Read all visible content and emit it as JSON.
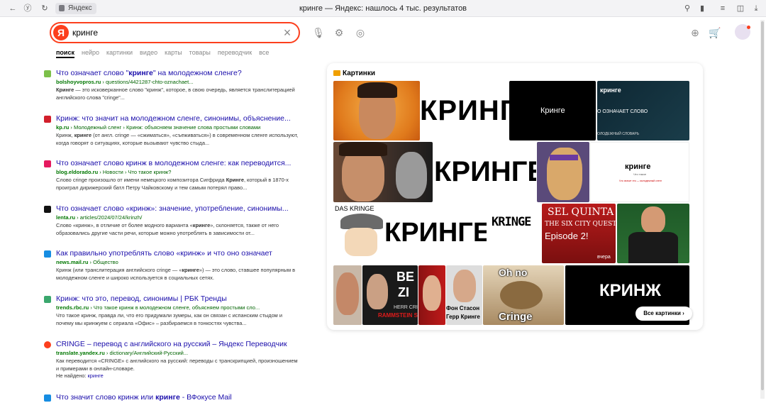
{
  "browser": {
    "site_chip": "Яндекс",
    "page_title": "кринге — Яндекс: нашлось 4 тыс. результатов"
  },
  "search": {
    "logo": "Я",
    "query": "кринге"
  },
  "tabs": [
    "поиск",
    "нейро",
    "картинки",
    "видео",
    "карты",
    "товары",
    "переводчик",
    "все"
  ],
  "results": [
    {
      "title_pre": "Что означает слово \"",
      "title_bold": "кринге",
      "title_post": "\" на молодежном сленге?",
      "host": "bolshoyvopros.ru",
      "path": " › questions/4421287-chto-oznachaet...",
      "snippet_bold": "Кринге",
      "snippet": " — это исковерканное слово \"кринж\", которое, в свою очередь, является транслитерацией английского слова \"cringe\"..."
    },
    {
      "title_pre": "Кринж: что значит на молодежном сленге, синонимы, объяснение...",
      "title_bold": "",
      "title_post": "",
      "host": "kp.ru",
      "path": " › Молодежный сленг › Кринж: объясняем значение слова простыми словами",
      "snippet_pre": "Кринж, ",
      "snippet_bold": "кринге",
      "snippet": " (от англ. cringe — «сжиматься», «съеживаться») в современном сленге используют, когда говорят о ситуациях, которые вызывают чувство стыда..."
    },
    {
      "title_pre": "Что означает слово кринж в молодежном сленге: как переводится...",
      "title_bold": "",
      "title_post": "",
      "host": "blog.eldorado.ru",
      "path": " › Новости › Что такое кринж?",
      "snippet_pre": "Слово cringe произошло от имени немецкого композитора Сигфрида ",
      "snippet_bold": "Кринге",
      "snippet": ", который в 1870-х проиграл дирижерский батл Петру Чайковскому и тем самым потерял право..."
    },
    {
      "title_pre": "Что означает слово «кринж»: значение, употребление, синонимы...",
      "title_bold": "",
      "title_post": "",
      "host": "lenta.ru",
      "path": " › articles/2024/07/24/krinzh/",
      "snippet_pre": "Слово «кринж», в отличие от более модного варианта «",
      "snippet_bold": "кринге",
      "snippet": "», склоняется, также от него образовались другие части речи, которые можно употреблять в зависимости от..."
    },
    {
      "title_pre": "Как правильно употреблять слово «кринж» и что оно означает",
      "title_bold": "",
      "title_post": "",
      "host": "news.mail.ru",
      "path": " › Общество",
      "snippet_pre": "Кринж (или транслитерация английского cringe — «",
      "snippet_bold": "кринге",
      "snippet": "») — это слово, ставшее популярным в молодежном сленге и широко используется в социальных сетях."
    },
    {
      "title_pre": "Кринж: что это, перевод, синонимы | РБК Тренды",
      "title_bold": "",
      "title_post": "",
      "host": "trends.rbc.ru",
      "path": " › Что такое кринж в молодежном сленге, объясняем простыми сло...",
      "snippet_pre": "",
      "snippet_bold": "",
      "snippet": "Что такое кринж, правда ли, что его придумали зумеры, как он связан с испанским стыдом и почему мы кринжуем с сериала «Офис» – разбираемся в тонкостях чувства..."
    },
    {
      "title_pre": "CRINGE – перевод с английского на русский – Яндекс Переводчик",
      "title_bold": "",
      "title_post": "",
      "host": "translate.yandex.ru",
      "path": " › dictionary/Английский-Русский...",
      "snippet_pre": "",
      "snippet_bold": "",
      "snippet": "Как переводится «CRINGE» с английского на русский: переводы с транскрипцией, произношением и примерами в онлайн-словаре.",
      "missing_label": "Не найдено: ",
      "missing_word": "кринге"
    },
    {
      "title_pre": "Что значит слово кринж или ",
      "title_bold": "кринге",
      "title_post": " - ВФокусе Mail",
      "host": "",
      "path": "",
      "snippet_pre": "",
      "snippet_bold": "",
      "snippet": ""
    }
  ],
  "images": {
    "heading": "Картинки",
    "all_button": "Все картинки ›",
    "thumb_texts": {
      "t2": "КРИНГЕ",
      "t3": "Кринге",
      "t4_top": "кринге",
      "t4_mid": "О ОЗНАЧАЕТ СЛОВО",
      "t4_bot": "ОЛОДЕЖНЫЙ СЛОВАРЬ",
      "t6": "КРИНГЕ",
      "t8_title": "кринге",
      "t8_sub": "Что такое",
      "t8_red": "Что значит это — молодежный сленг",
      "t9_top": "DAS KRINGE",
      "t10": "КРИНГЕ",
      "t11": "KRINGE",
      "t12_a": "SEL QUINTA",
      "t12_b": "THE SIX CITY QUEST",
      "t12_c": "Episode 2!",
      "t12_d": "вчера",
      "t15_a": "BE",
      "t15_b": "ZI",
      "t15_c": "HERR CRI",
      "t15_d": "RAMMSTEIN S",
      "t17_a": "Фон Стасон",
      "t17_b": "Герр Кринге",
      "t18_a": "Oh no",
      "t18_b": "Cringe",
      "t19": "КРИНЖ"
    }
  },
  "colors": {
    "accent": "#fc3f1d",
    "link": "#1a0dab",
    "url_green": "#006400"
  }
}
